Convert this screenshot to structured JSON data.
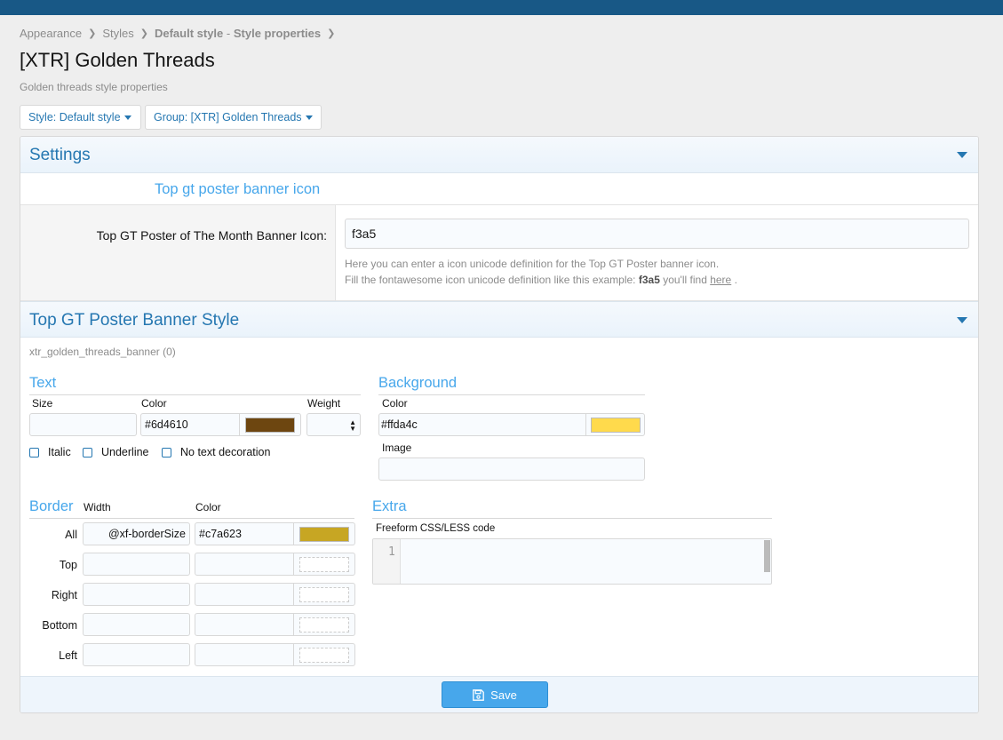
{
  "breadcrumb": {
    "items": [
      "Appearance",
      "Styles",
      "Default style",
      "-",
      "Style properties"
    ]
  },
  "page": {
    "title": "[XTR] Golden Threads",
    "description": "Golden threads style properties"
  },
  "menus": {
    "style_label": "Style: Default style",
    "group_label": "Group: [XTR] Golden Threads"
  },
  "settings": {
    "header": "Settings",
    "subheader": "Top gt poster banner icon",
    "field_label": "Top GT Poster of The Month Banner Icon:",
    "field_value": "f3a5",
    "hint_line1": "Here you can enter a icon unicode definition for the Top GT Poster banner icon.",
    "hint_line2_pre": "Fill the fontawesome icon unicode definition like this example: ",
    "hint_line2_bold": "f3a5",
    "hint_line2_mid": " you'll find ",
    "hint_line2_link": "here",
    "hint_line2_post": " ."
  },
  "banner_style": {
    "header": "Top GT Poster Banner Style",
    "property_name": "xtr_golden_threads_banner (0)",
    "text": {
      "title": "Text",
      "size_label": "Size",
      "size_value": "",
      "color_label": "Color",
      "color_value": "#6d4610",
      "weight_label": "Weight",
      "checkboxes": [
        "Italic",
        "Underline",
        "No text decoration"
      ]
    },
    "background": {
      "title": "Background",
      "color_label": "Color",
      "color_value": "#ffda4c",
      "image_label": "Image",
      "image_value": ""
    },
    "border": {
      "title": "Border",
      "width_label": "Width",
      "color_label": "Color",
      "rows": [
        {
          "label": "All",
          "width": "@xf-borderSize",
          "color": "#c7a623"
        },
        {
          "label": "Top",
          "width": "",
          "color": ""
        },
        {
          "label": "Right",
          "width": "",
          "color": ""
        },
        {
          "label": "Bottom",
          "width": "",
          "color": ""
        },
        {
          "label": "Left",
          "width": "",
          "color": ""
        }
      ]
    },
    "extra": {
      "title": "Extra",
      "code_label": "Freeform CSS/LESS code",
      "line_number": "1"
    }
  },
  "footer": {
    "save_label": "Save"
  },
  "colors": {
    "topbar": "#185886",
    "accent": "#2577b1",
    "text_swatch": "#6d4610",
    "bg_swatch": "#ffda4c",
    "border_swatch": "#c7a623"
  }
}
